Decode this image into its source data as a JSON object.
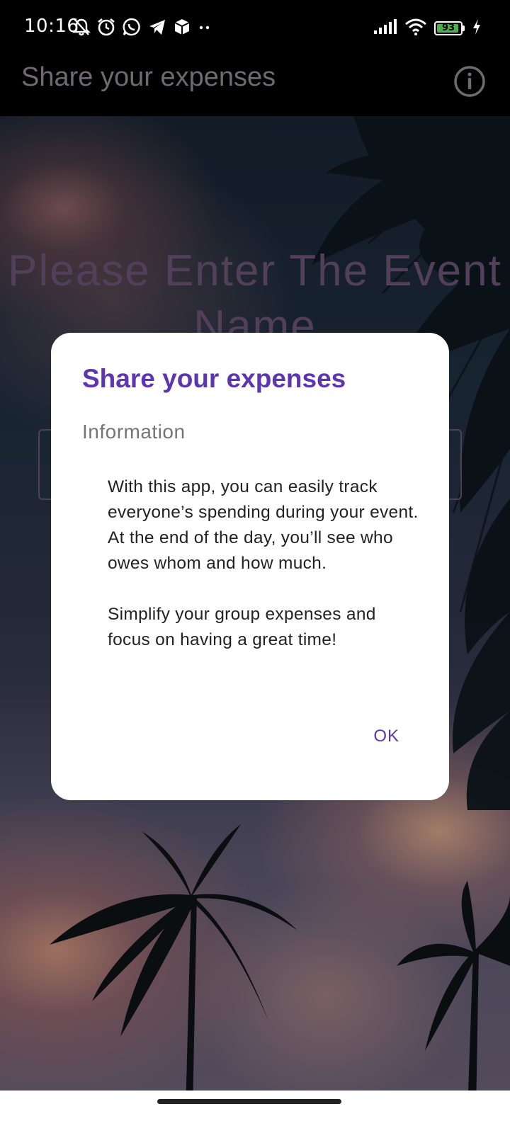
{
  "status_bar": {
    "time": "10:16",
    "battery_level": "93",
    "battery_fraction": 0.93,
    "icons_left": [
      "bell-off-icon",
      "alarm-icon",
      "whatsapp-icon",
      "telegram-icon",
      "box-icon",
      "more-dots-icon"
    ],
    "icons_right": [
      "signal-icon",
      "wifi-icon",
      "battery-icon",
      "charging-icon"
    ]
  },
  "app_bar": {
    "title": "Share your expenses",
    "info_icon": "info-icon"
  },
  "background": {
    "heading": "Please Enter The Event Name"
  },
  "dialog": {
    "title": "Share your expenses",
    "subtitle": "Information",
    "body_line_1": "With this app, you can easily track everyone’s spending during your event.",
    "body_line_2": "At the end of the day, you’ll see who owes whom and how much.",
    "body_line_3": "Simplify your group expenses and focus on having a great time!",
    "ok_label": "OK"
  },
  "colors": {
    "accent": "#5e35b1",
    "app_title": "#6e6a72",
    "battery": "#4caf50"
  }
}
